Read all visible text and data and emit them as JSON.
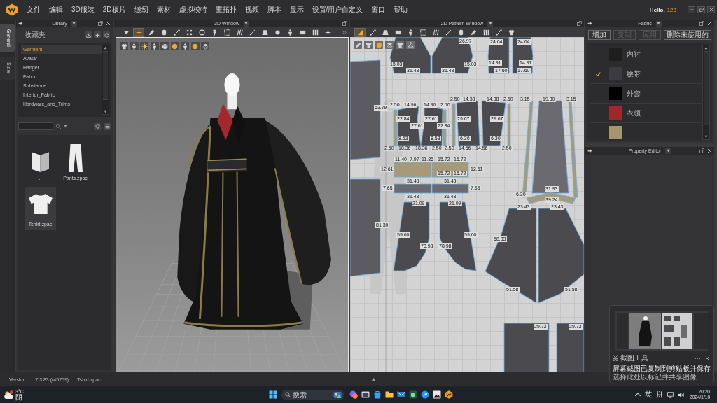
{
  "menubar": {
    "items": [
      "文件",
      "编辑",
      "3D服装",
      "2D板片",
      "缝纫",
      "素材",
      "虚拟模特",
      "重拓扑",
      "视频",
      "脚本",
      "显示",
      "设置/用户自定义",
      "窗口",
      "帮助"
    ],
    "greeting": "Hello,",
    "user": "123"
  },
  "side_tabs": [
    {
      "label": "General",
      "selected": true
    },
    {
      "label": "Store",
      "selected": false
    }
  ],
  "library": {
    "title": "Library",
    "favorites": "收藏夹",
    "categories": [
      {
        "label": "Garment",
        "selected": true
      },
      {
        "label": "Avatar",
        "selected": false
      },
      {
        "label": "Hanger",
        "selected": false
      },
      {
        "label": "Fabric",
        "selected": false
      },
      {
        "label": "Substance",
        "selected": false
      },
      {
        "label": "Interior_Fabric",
        "selected": false
      },
      {
        "label": "Hardware_and_Trims",
        "selected": false
      }
    ],
    "files": [
      {
        "kind": "folder",
        "label": "..",
        "selected": false
      },
      {
        "kind": "pants",
        "label": "Pants.zpac",
        "selected": false
      },
      {
        "kind": "tshirt",
        "label": "Tshirt.zpac",
        "selected": true
      }
    ]
  },
  "window_3d": {
    "title": "3D Window",
    "tools": [
      {
        "selected": false
      },
      {
        "selected": true
      },
      {
        "selected": false
      },
      {
        "selected": false
      },
      {
        "selected": false
      },
      {
        "selected": false
      },
      {
        "selected": false
      },
      {
        "selected": false
      },
      {
        "selected": false
      },
      {
        "selected": false
      },
      {
        "selected": false
      },
      {
        "selected": false
      },
      {
        "selected": false
      },
      {
        "selected": false
      },
      {
        "selected": false
      },
      {
        "selected": false
      },
      {
        "selected": false
      }
    ]
  },
  "pattern_window": {
    "title": "2D Pattern Window",
    "tools": [
      {
        "selected": true
      },
      {
        "selected": false
      },
      {
        "selected": false
      },
      {
        "selected": false
      },
      {
        "selected": false
      },
      {
        "selected": false
      },
      {
        "selected": false
      },
      {
        "selected": false
      },
      {
        "selected": false
      },
      {
        "selected": false
      },
      {
        "selected": false
      },
      {
        "selected": false
      },
      {
        "selected": false
      }
    ],
    "pieces": [
      {
        "color": "#4b4b4f",
        "labels": [
          "15.03",
          "31.43"
        ]
      },
      {
        "color": "#4b4b4f",
        "labels": [
          "26.97",
          "15.03",
          "31.43"
        ]
      },
      {
        "color": "#4b4b4f",
        "labels": [
          "24.64",
          "14.91",
          "17.60"
        ]
      },
      {
        "color": "#4b4b4f",
        "labels": [
          "24.64",
          "14.91",
          "17.60"
        ]
      },
      {
        "color": "#a69a78",
        "labels": [
          "2.50",
          "2.50"
        ]
      },
      {
        "color": "#4b4b4f",
        "labels": [
          "14.96",
          "22.84",
          "27.61",
          "8.53",
          "18.36"
        ]
      },
      {
        "color": "#4b4b4f",
        "labels": [
          "14.96",
          "27.61",
          "22.84",
          "8.53",
          "18.36"
        ]
      },
      {
        "color": "#a69a78",
        "labels": [
          "2.50",
          "2.50"
        ]
      },
      {
        "color": "#a69a78",
        "labels": [
          "2.50",
          "2.50"
        ]
      },
      {
        "color": "#4b4b4f",
        "labels": [
          "14.38",
          "29.67",
          "6.30",
          "14.56"
        ]
      },
      {
        "color": "#4b4b4f",
        "labels": [
          "14.38",
          "29.67",
          "6.30",
          "14.56"
        ]
      },
      {
        "color": "#a69a78",
        "labels": [
          "2.50",
          "2.50"
        ]
      },
      {
        "color": "#a69a78",
        "labels": [
          "3.15",
          "6.30"
        ]
      },
      {
        "color": "#6b6a70",
        "labels": [
          "19.80",
          "31.93"
        ]
      },
      {
        "color": "#a69a78",
        "labels": [
          "3.15"
        ]
      },
      {
        "color": "#a69a78",
        "labels": [
          "39.24"
        ]
      },
      {
        "color": "#a69a78",
        "labels": [
          "11.40",
          "7.97",
          "11.86",
          "12.61"
        ]
      },
      {
        "color": "#a69a78",
        "labels": [
          "15.72",
          "15.72",
          "12.61",
          "15.72",
          "15.72"
        ]
      },
      {
        "color": "#6b6a70",
        "labels": [
          "31.43",
          "7.65",
          "31.43"
        ]
      },
      {
        "color": "#6b6a70",
        "labels": [
          "31.43",
          "7.65",
          "31.43"
        ]
      },
      {
        "color": "#4b4b4f",
        "labels": [
          "21.09",
          "59.60",
          "78.98"
        ]
      },
      {
        "color": "#4b4b4f",
        "labels": [
          "21.09",
          "59.60",
          "78.98"
        ]
      },
      {
        "color": "#4b4b4f",
        "labels": [
          "23.43",
          "58.33",
          "51.58"
        ]
      },
      {
        "color": "#4b4b4f",
        "labels": [
          "23.43",
          "51.58"
        ]
      },
      {
        "color": "#5c5c60",
        "labels": [
          "63.79"
        ]
      },
      {
        "color": "#5c5c60",
        "labels": [
          "81.30"
        ]
      },
      {
        "color": "#4b4b4f",
        "labels": [
          "29.73"
        ]
      },
      {
        "color": "#4b4b4f",
        "labels": [
          "29.73"
        ]
      }
    ]
  },
  "fabric": {
    "title": "Fabric",
    "buttons": [
      {
        "label": "增加",
        "disabled": false
      },
      {
        "label": "复制",
        "disabled": true
      },
      {
        "label": "应用",
        "disabled": true
      },
      {
        "label": "删除未使用的",
        "disabled": false
      }
    ],
    "items": [
      {
        "name": "内衬",
        "color": "#1e1e1e",
        "checked": false
      },
      {
        "name": "腰带",
        "color": "#3b3b41",
        "checked": true
      },
      {
        "name": "外套",
        "color": "#000000",
        "checked": false
      },
      {
        "name": "衣领",
        "color": "#9a2a2b",
        "checked": false
      },
      {
        "color": "#a4976e",
        "checked": false
      }
    ]
  },
  "property_editor": {
    "title": "Property Editor"
  },
  "status_bar": {
    "version_label": "Version:",
    "version": "7.3.83 (r45759)",
    "file": "Tshirt.zpac"
  },
  "notification": {
    "app": "截图工具",
    "title": "屏幕截图已复制到剪贴板并保存",
    "body": "选择此处以标记并共享图像"
  },
  "taskbar": {
    "temperature": "3°C",
    "weather": "阴",
    "search": {
      "placeholder": "搜索"
    },
    "input_language": "英",
    "input_mode": "拼",
    "time": "20:20",
    "date": "2024/1/10"
  }
}
